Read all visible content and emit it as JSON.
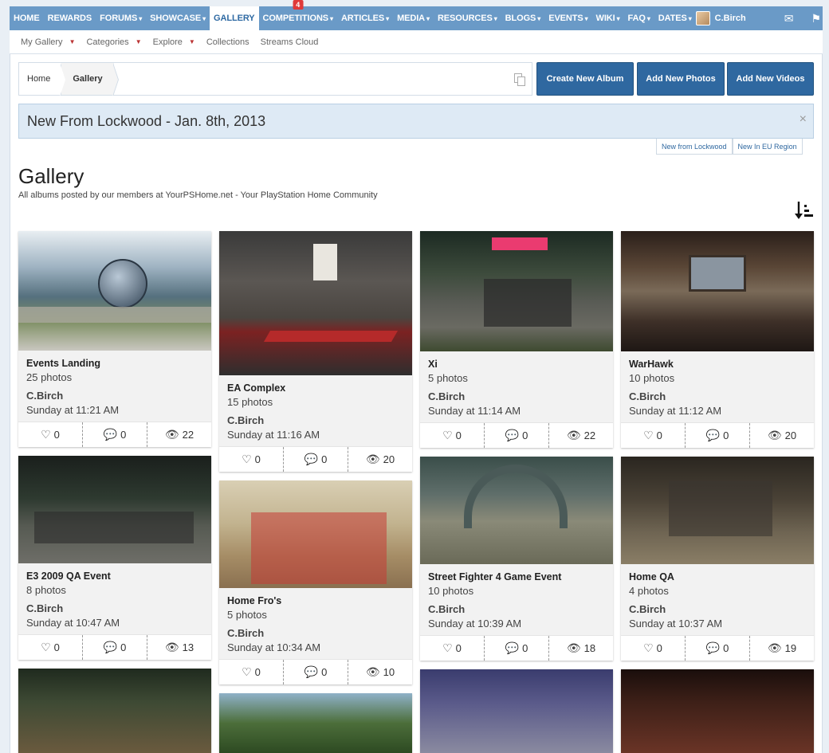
{
  "nav": {
    "items": [
      {
        "label": "HOME",
        "caret": false
      },
      {
        "label": "REWARDS",
        "caret": false
      },
      {
        "label": "FORUMS",
        "caret": true
      },
      {
        "label": "SHOWCASE",
        "caret": true
      },
      {
        "label": "GALLERY",
        "caret": false,
        "active": true
      },
      {
        "label": "COMPETITIONS",
        "caret": true,
        "badge": "4"
      },
      {
        "label": "ARTICLES",
        "caret": true
      },
      {
        "label": "MEDIA",
        "caret": true
      },
      {
        "label": "RESOURCES",
        "caret": true
      },
      {
        "label": "BLOGS",
        "caret": true
      },
      {
        "label": "EVENTS",
        "caret": true
      },
      {
        "label": "WIKI",
        "caret": true
      },
      {
        "label": "FAQ",
        "caret": true
      },
      {
        "label": "DATES",
        "caret": true
      }
    ],
    "user": "C.Birch",
    "icons": [
      "envelope-icon",
      "flag-icon"
    ]
  },
  "subnav": {
    "items": [
      {
        "label": "My Gallery",
        "caret": true
      },
      {
        "label": "Categories",
        "caret": true
      },
      {
        "label": "Explore",
        "caret": true
      },
      {
        "label": "Collections",
        "caret": false
      },
      {
        "label": "Streams Cloud",
        "caret": false
      }
    ]
  },
  "breadcrumb": {
    "home": "Home",
    "current": "Gallery"
  },
  "buttons": {
    "create_album": "Create New Album",
    "add_photos": "Add New Photos",
    "add_videos": "Add New Videos"
  },
  "notice": {
    "text": "New From Lockwood - Jan. 8th, 2013",
    "close": "×",
    "tabs": [
      "New from Lockwood",
      "New In EU Region"
    ]
  },
  "page": {
    "title": "Gallery",
    "description": "All albums posted by our members at YourPSHome.net - Your PlayStation Home Community"
  },
  "albums": [
    {
      "title": "Events Landing",
      "count": "25 photos",
      "owner": "C.Birch",
      "date": "Sunday at 11:21 AM",
      "likes": "0",
      "comments": "0",
      "views": "22"
    },
    {
      "title": "EA Complex",
      "count": "15 photos",
      "owner": "C.Birch",
      "date": "Sunday at 11:16 AM",
      "likes": "0",
      "comments": "0",
      "views": "20"
    },
    {
      "title": "Xi",
      "count": "5 photos",
      "owner": "C.Birch",
      "date": "Sunday at 11:14 AM",
      "likes": "0",
      "comments": "0",
      "views": "22"
    },
    {
      "title": "WarHawk",
      "count": "10 photos",
      "owner": "C.Birch",
      "date": "Sunday at 11:12 AM",
      "likes": "0",
      "comments": "0",
      "views": "20"
    },
    {
      "title": "E3 2009 QA Event",
      "count": "8 photos",
      "owner": "C.Birch",
      "date": "Sunday at 10:47 AM",
      "likes": "0",
      "comments": "0",
      "views": "13"
    },
    {
      "title": "Home Fro's",
      "count": "5 photos",
      "owner": "C.Birch",
      "date": "Sunday at 10:34 AM",
      "likes": "0",
      "comments": "0",
      "views": "10"
    },
    {
      "title": "Street Fighter 4 Game Event",
      "count": "10 photos",
      "owner": "C.Birch",
      "date": "Sunday at 10:39 AM",
      "likes": "0",
      "comments": "0",
      "views": "18"
    },
    {
      "title": "Home QA",
      "count": "4 photos",
      "owner": "C.Birch",
      "date": "Sunday at 10:37 AM",
      "likes": "0",
      "comments": "0",
      "views": "19"
    }
  ],
  "colors": {
    "nav": "#6a9ac7",
    "button": "#2f68a0",
    "notice": "#deeaf5"
  }
}
